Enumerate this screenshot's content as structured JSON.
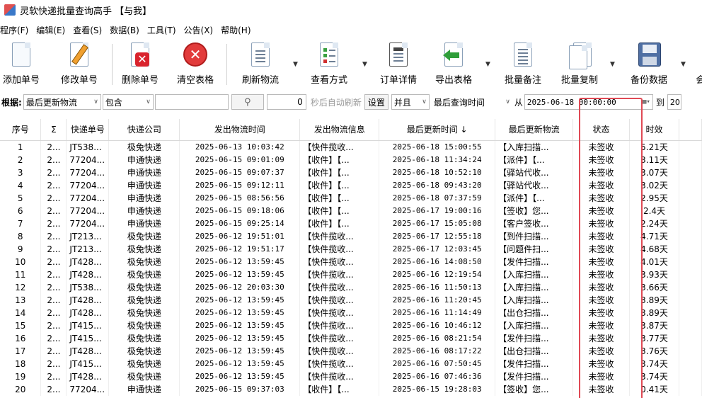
{
  "window": {
    "title": "灵软快递批量查询高手 【与我】"
  },
  "menu": [
    "程序(F)",
    "编辑(E)",
    "查看(S)",
    "数据(B)",
    "工具(T)",
    "公告(X)",
    "帮助(H)"
  ],
  "toolbar": {
    "add": "添加单号",
    "edit": "修改单号",
    "delete": "删除单号",
    "clear": "清空表格",
    "refresh": "刷新物流",
    "view": "查看方式",
    "detail": "订单详情",
    "export": "导出表格",
    "note": "批量备注",
    "copy": "批量复制",
    "backup": "备份数据",
    "more": "会"
  },
  "filter": {
    "label": "根据:",
    "field": "最后更新物流",
    "op": "包含",
    "value": "",
    "seconds": "0",
    "auto_refresh": "秒后自动刷新",
    "settings": "设置",
    "logic": "并且",
    "time_field": "最后查询时间",
    "from_label": "从",
    "from_value": "2025-06-18 00:00:00",
    "to_label": "到",
    "to_value": "20"
  },
  "colors": {
    "highlight": "#e04a55",
    "accent": "#3a78c8"
  },
  "table": {
    "headers": [
      "序号",
      "Σ",
      "快递单号",
      "快递公司",
      "发出物流时间",
      "发出物流信息",
      "最后更新时间 ↓",
      "最后更新物流",
      "状态",
      "时效"
    ],
    "rows": [
      [
        "1",
        "2...",
        "JT538...",
        "极兔快递",
        "2025-06-13 10:03:42",
        "【快件揽收...",
        "2025-06-18 15:00:55",
        "【入库扫描...",
        "未签收",
        "5.21天"
      ],
      [
        "2",
        "2...",
        "77204...",
        "申通快递",
        "2025-06-15 09:01:09",
        "【收件】【...",
        "2025-06-18 11:34:24",
        "【派件】【...",
        "未签收",
        "3.11天"
      ],
      [
        "3",
        "2...",
        "77204...",
        "申通快递",
        "2025-06-15 09:07:37",
        "【收件】【...",
        "2025-06-18 10:52:10",
        "【驿站代收...",
        "未签收",
        "3.07天"
      ],
      [
        "4",
        "2...",
        "77204...",
        "申通快递",
        "2025-06-15 09:12:11",
        "【收件】【...",
        "2025-06-18 09:43:20",
        "【驿站代收...",
        "未签收",
        "3.02天"
      ],
      [
        "5",
        "2...",
        "77204...",
        "申通快递",
        "2025-06-15 08:56:56",
        "【收件】【...",
        "2025-06-18 07:37:59",
        "【派件】【...",
        "未签收",
        "2.95天"
      ],
      [
        "6",
        "2...",
        "77204...",
        "申通快递",
        "2025-06-15 09:18:06",
        "【收件】【...",
        "2025-06-17 19:00:16",
        "【签收】您...",
        "未签收",
        "2.4天"
      ],
      [
        "7",
        "2...",
        "77204...",
        "申通快递",
        "2025-06-15 09:25:14",
        "【收件】【...",
        "2025-06-17 15:05:08",
        "【客户签收...",
        "未签收",
        "2.24天"
      ],
      [
        "8",
        "2...",
        "JT213...",
        "极兔快递",
        "2025-06-12 19:51:01",
        "【快件揽收...",
        "2025-06-17 12:55:18",
        "【到件扫描...",
        "未签收",
        "4.71天"
      ],
      [
        "9",
        "2...",
        "JT213...",
        "极兔快递",
        "2025-06-12 19:51:17",
        "【快件揽收...",
        "2025-06-17 12:03:45",
        "【问题件扫...",
        "未签收",
        "4.68天"
      ],
      [
        "10",
        "2...",
        "JT428...",
        "极兔快递",
        "2025-06-12 13:59:45",
        "【快件揽收...",
        "2025-06-16 14:08:50",
        "【发件扫描...",
        "未签收",
        "4.01天"
      ],
      [
        "11",
        "2...",
        "JT428...",
        "极兔快递",
        "2025-06-12 13:59:45",
        "【快件揽收...",
        "2025-06-16 12:19:54",
        "【入库扫描...",
        "未签收",
        "3.93天"
      ],
      [
        "12",
        "2...",
        "JT538...",
        "极兔快递",
        "2025-06-12 20:03:30",
        "【快件揽收...",
        "2025-06-16 11:50:13",
        "【入库扫描...",
        "未签收",
        "3.66天"
      ],
      [
        "13",
        "2...",
        "JT428...",
        "极兔快递",
        "2025-06-12 13:59:45",
        "【快件揽收...",
        "2025-06-16 11:20:45",
        "【入库扫描...",
        "未签收",
        "3.89天"
      ],
      [
        "14",
        "2...",
        "JT428...",
        "极兔快递",
        "2025-06-12 13:59:45",
        "【快件揽收...",
        "2025-06-16 11:14:49",
        "【出仓扫描...",
        "未签收",
        "3.89天"
      ],
      [
        "15",
        "2...",
        "JT415...",
        "极兔快递",
        "2025-06-12 13:59:45",
        "【快件揽收...",
        "2025-06-16 10:46:12",
        "【入库扫描...",
        "未签收",
        "3.87天"
      ],
      [
        "16",
        "2...",
        "JT415...",
        "极兔快递",
        "2025-06-12 13:59:45",
        "【快件揽收...",
        "2025-06-16 08:21:54",
        "【发件扫描...",
        "未签收",
        "3.77天"
      ],
      [
        "17",
        "2...",
        "JT428...",
        "极兔快递",
        "2025-06-12 13:59:45",
        "【快件揽收...",
        "2025-06-16 08:17:22",
        "【出仓扫描...",
        "未签收",
        "3.76天"
      ],
      [
        "18",
        "2...",
        "JT415...",
        "极兔快递",
        "2025-06-12 13:59:45",
        "【快件揽收...",
        "2025-06-16 07:50:45",
        "【发件扫描...",
        "未签收",
        "3.74天"
      ],
      [
        "19",
        "2...",
        "JT428...",
        "极兔快递",
        "2025-06-12 13:59:45",
        "【快件揽收...",
        "2025-06-16 07:46:36",
        "【发件扫描...",
        "未签收",
        "3.74天"
      ],
      [
        "20",
        "2...",
        "77204...",
        "申通快递",
        "2025-06-15 09:37:03",
        "【收件】【...",
        "2025-06-15 19:28:03",
        "【签收】您...",
        "未签收",
        "0.41天"
      ]
    ]
  }
}
